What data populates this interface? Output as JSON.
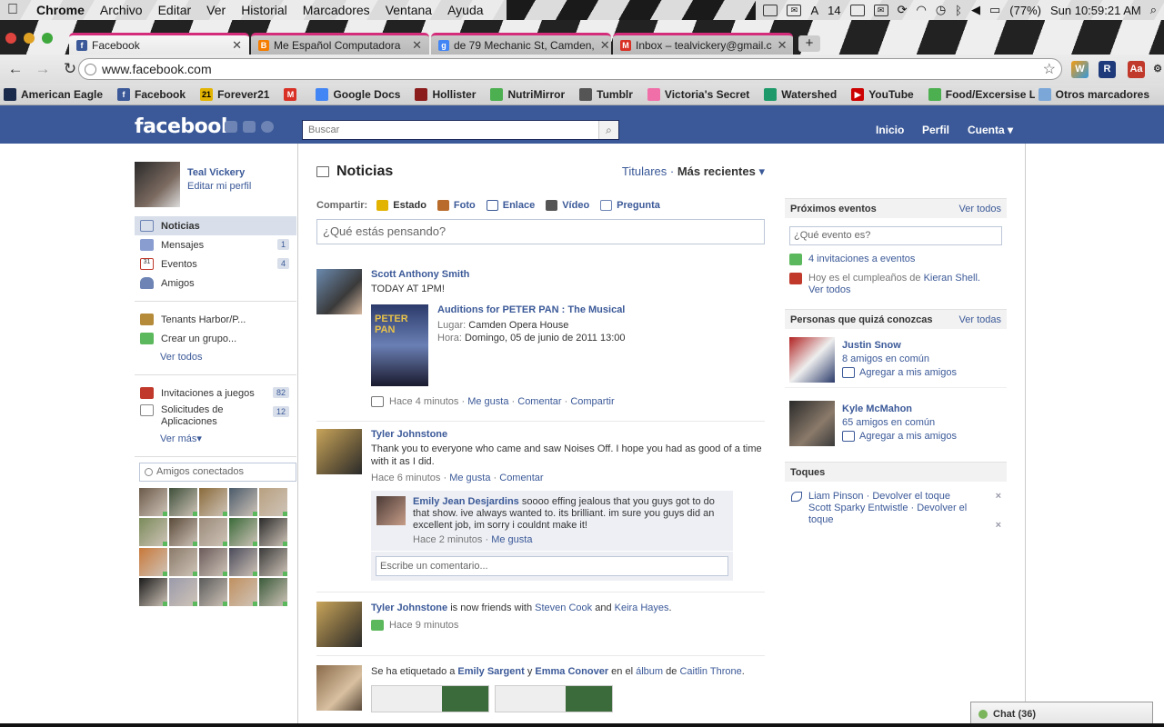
{
  "menubar": {
    "app": "Chrome",
    "menus": [
      "Archivo",
      "Editar",
      "Ver",
      "Historial",
      "Marcadores",
      "Ventana",
      "Ayuda"
    ],
    "status_number": "14",
    "battery": "(77%)",
    "clock": "Sun 10:59:21 AM"
  },
  "tabs": [
    {
      "title": "Facebook",
      "favicon": "facebook-icon",
      "color": "#3b5998"
    },
    {
      "title": "Me Español Computadora",
      "favicon": "blogger-icon",
      "color": "#f57d00"
    },
    {
      "title": "de 79 Mechanic St, Camden,",
      "favicon": "google-icon",
      "color": "#4285f4"
    },
    {
      "title": "Inbox – tealvickery@gmail.c",
      "favicon": "gmail-icon",
      "color": "#d93025"
    }
  ],
  "browser": {
    "url": "www.facebook.com",
    "new_tab": "+"
  },
  "bookmarks": [
    {
      "label": "American Eagle",
      "color": "#1a2a4a"
    },
    {
      "label": "Facebook",
      "color": "#3b5998"
    },
    {
      "label": "Forever21",
      "color": "#e2b300"
    },
    {
      "label": "",
      "color": "#d93025"
    },
    {
      "label": "Google Docs",
      "color": "#4285f4"
    },
    {
      "label": "Hollister",
      "color": "#8b1c1c"
    },
    {
      "label": "NutriMirror",
      "color": "#4caf50"
    },
    {
      "label": "Tumblr",
      "color": "#555"
    },
    {
      "label": "Victoria's Secret",
      "color": "#f06fa8"
    },
    {
      "label": "Watershed",
      "color": "#1e9a6a"
    },
    {
      "label": "YouTube",
      "color": "#cc0000"
    },
    {
      "label": "Food/Excersise Log",
      "color": "#4caf50"
    }
  ],
  "bookmarks_other": "Otros marcadores",
  "fb": {
    "logo": "facebook",
    "search_placeholder": "Buscar",
    "nav": {
      "home": "Inicio",
      "profile": "Perfil",
      "account": "Cuenta"
    }
  },
  "profile": {
    "name": "Teal Vickery",
    "edit": "Editar mi perfil"
  },
  "leftnav": {
    "main": [
      {
        "label": "Noticias",
        "count": "",
        "color": "#6d84b4"
      },
      {
        "label": "Mensajes",
        "count": "1",
        "color": "#8a9dd0"
      },
      {
        "label": "Eventos",
        "count": "4",
        "color": "#c0392b"
      },
      {
        "label": "Amigos",
        "count": "",
        "color": "#6d84b4"
      }
    ],
    "groups": [
      {
        "label": "Tenants Harbor/P...",
        "color": "#b58b3a"
      },
      {
        "label": "Crear un grupo...",
        "color": "#5cb85c"
      }
    ],
    "groups_more": "Ver todos",
    "apps": [
      {
        "label": "Invitaciones a juegos",
        "count": "82",
        "color": "#c0392b"
      },
      {
        "label": "Solicitudes de Aplicaciones",
        "count": "12",
        "color": "#888"
      }
    ],
    "apps_more": "Ver más",
    "friends_search": "Amigos conectados",
    "online_colors": [
      "#6b5a4a",
      "#3e4f3a",
      "#8a6b3b",
      "#4a5a6a",
      "#b8a080",
      "#7a8a5a",
      "#5a4a3a",
      "#9a8a7a",
      "#3a6a3a",
      "#2a2a2a",
      "#c8783a",
      "#8a7a6a",
      "#6a5a5a",
      "#4a4a5a",
      "#3a3a3a",
      "#1a1a1a",
      "#9a9aaa",
      "#5a5a5a",
      "#c09060",
      "#3a5a3a"
    ]
  },
  "center": {
    "title": "Noticias",
    "sort_top": "Titulares",
    "sort_recent": "Más recientes",
    "composer": {
      "label": "Compartir:",
      "options": [
        {
          "label": "Estado",
          "color": "#e2b300"
        },
        {
          "label": "Foto",
          "color": "#b86b2b"
        },
        {
          "label": "Enlace",
          "color": "#3b5998"
        },
        {
          "label": "Vídeo",
          "color": "#555"
        },
        {
          "label": "Pregunta",
          "color": "#6d84b4"
        }
      ],
      "placeholder": "¿Qué estás pensando?"
    },
    "stories": [
      {
        "actor": "Scott Anthony Smith",
        "message": "TODAY AT 1PM!",
        "event": {
          "title": "Auditions for PETER PAN : The Musical",
          "poster_text": "PETER PAN",
          "place_label": "Lugar:",
          "place": "Camden Opera House",
          "time_label": "Hora:",
          "time": "Domingo, 05 de junio de 2011 13:00"
        },
        "time": "Hace 4 minutos",
        "like": "Me gusta",
        "comment": "Comentar",
        "share": "Compartir"
      },
      {
        "actor": "Tyler Johnstone",
        "message": "Thank you to everyone who came and saw Noises Off. I hope you had as good of a time with it as I did.",
        "time": "Hace 6 minutos",
        "like": "Me gusta",
        "comment": "Comentar",
        "reply": {
          "author": "Emily Jean Desjardins",
          "text": "soooo effing jealous that you guys got to do that show. ive always wanted to. its brilliant. im sure you guys did an excellent job, im sorry i couldnt make it!",
          "time": "Hace 2 minutos",
          "like": "Me gusta"
        },
        "write_comment": "Escribe un comentario..."
      },
      {
        "actor": "Tyler Johnstone",
        "text1": "is now friends with",
        "friend1": "Steven Cook",
        "and": "and",
        "friend2": "Keira Hayes",
        "time": "Hace 9 minutos"
      },
      {
        "prefix": "Se ha etiquetado a",
        "person1": "Emily Sargent",
        "y": "y",
        "person2": "Emma Conover",
        "mid": "en el",
        "album": "álbum",
        "de": "de",
        "owner": "Caitlin Throne"
      }
    ]
  },
  "right": {
    "events": {
      "title": "Próximos eventos",
      "see_all": "Ver todos",
      "placeholder": "¿Qué evento es?",
      "invites": "4 invitaciones a eventos",
      "birthday_prefix": "Hoy es el cumpleaños de",
      "birthday_name": "Kieran Shell.",
      "birthday_more": "Ver todos"
    },
    "pymk": {
      "title": "Personas que quizá conozcas",
      "see_all": "Ver todas",
      "people": [
        {
          "name": "Justin Snow",
          "mutual": "8 amigos en común",
          "add": "Agregar a mis amigos"
        },
        {
          "name": "Kyle McMahon",
          "mutual": "65 amigos en común",
          "add": "Agregar a mis amigos"
        }
      ]
    },
    "pokes": {
      "title": "Toques",
      "items": [
        {
          "name": "Liam Pinson",
          "action": "Devolver el toque"
        },
        {
          "name": "Scott Sparky Entwistle",
          "action": "Devolver el toque"
        }
      ]
    }
  },
  "chat": {
    "label": "Chat (36)"
  }
}
